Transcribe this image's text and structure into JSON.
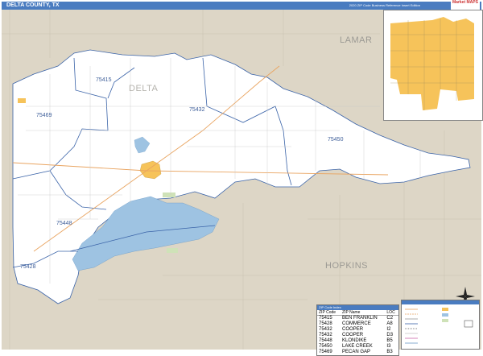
{
  "header": {
    "title": "DELTA COUNTY, TX",
    "edition": "2020 ZIP Code Business Reference Insert Edition"
  },
  "counties": {
    "delta": "DELTA",
    "lamar": "LAMAR",
    "hopkins": "HOPKINS"
  },
  "zip_labels": [
    "75415",
    "75469",
    "75432",
    "75450",
    "75448",
    "75428"
  ],
  "legend_table": {
    "title": "ZIP Code Index",
    "columns": [
      "ZIP Code",
      "ZIP Name",
      "LOC"
    ],
    "rows": [
      [
        "75415",
        "BEN FRANKLIN",
        "C2"
      ],
      [
        "75428",
        "COMMERCE",
        "A8"
      ],
      [
        "75432",
        "COOPER",
        "I2"
      ],
      [
        "75432",
        "COOPER",
        "D3"
      ],
      [
        "75448",
        "KLONDIKE",
        "B5"
      ],
      [
        "75450",
        "LAKE CREEK",
        "I3"
      ],
      [
        "75469",
        "PECAN GAP",
        "B3"
      ]
    ]
  },
  "logo": {
    "text": "Market MAPS"
  },
  "colors": {
    "title_bar": "#4a7cc0",
    "county_fill": "#ffffff",
    "surrounding": "#ddd6c6",
    "water": "#9ec3e2",
    "city": "#f6c35a",
    "zip_boundary": "#3a63a8"
  }
}
